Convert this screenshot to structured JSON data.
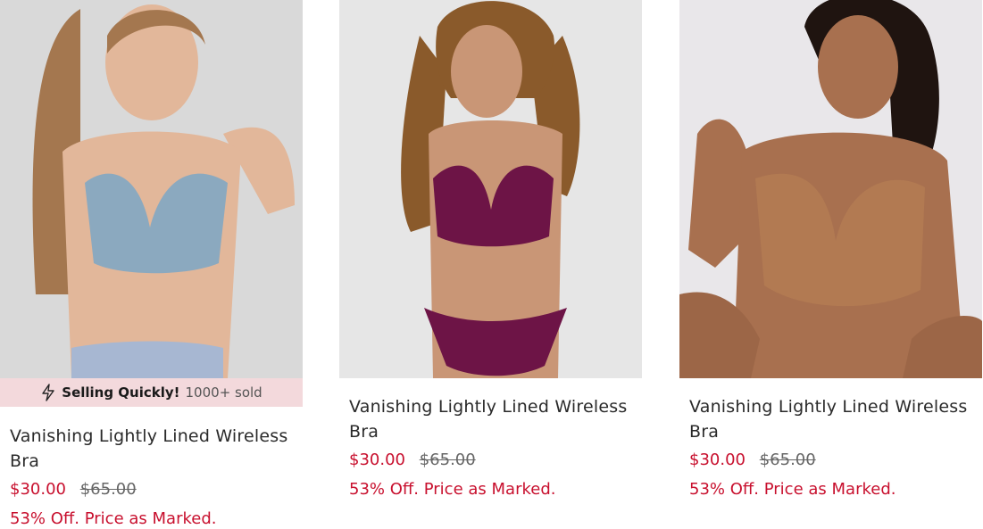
{
  "products": [
    {
      "title": "Vanishing Lightly Lined Wireless Bra",
      "price_sale": "$30.00",
      "price_original": "$65.00",
      "promo": "53% Off. Price as Marked.",
      "badge": {
        "icon": "lightning-icon",
        "strong": "Selling Quickly!",
        "count": "1000+ sold"
      },
      "colors": {
        "bg": "#d9d9d9",
        "skin": "#e2b79a",
        "hair": "#a4774f",
        "garment": "#8ba9bf"
      }
    },
    {
      "title": "Vanishing Lightly Lined Wireless Bra",
      "price_sale": "$30.00",
      "price_original": "$65.00",
      "promo": "53% Off. Price as Marked.",
      "colors": {
        "bg": "#e6e6e6",
        "skin": "#c99676",
        "hair": "#8a5a2b",
        "garment": "#6d1446"
      }
    },
    {
      "title": "Vanishing Lightly Lined Wireless Bra",
      "price_sale": "$30.00",
      "price_original": "$65.00",
      "promo": "53% Off. Price as Marked.",
      "colors": {
        "bg": "#e9e7ea",
        "skin": "#a8704f",
        "hair": "#1f1410",
        "garment": "#b27a52"
      }
    }
  ],
  "theme": {
    "sale": "#c8102e",
    "badge_bg": "#f3d9dc"
  }
}
